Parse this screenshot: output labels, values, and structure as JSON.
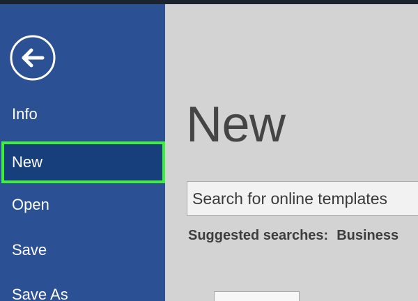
{
  "sidebar": {
    "back_icon": "arrow-left-circle-icon",
    "items": [
      {
        "label": "Info"
      },
      {
        "label": "New",
        "selected": true
      },
      {
        "label": "Open"
      },
      {
        "label": "Save"
      },
      {
        "label": "Save As"
      }
    ]
  },
  "main": {
    "title": "New",
    "search": {
      "placeholder": "Search for online templates"
    },
    "suggested": {
      "label": "Suggested searches:",
      "items": [
        "Business"
      ]
    }
  },
  "colors": {
    "sidebar_bg": "#2b5194",
    "selected_bg": "#173f7c",
    "highlight": "#3ef03e",
    "content_bg": "#d3d3d3"
  }
}
